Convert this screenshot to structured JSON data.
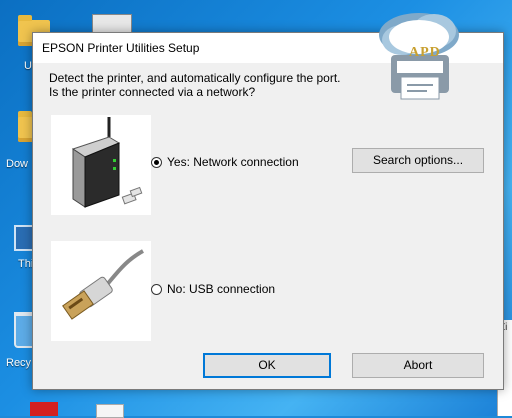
{
  "desktop": {
    "labels": [
      "U",
      "Dow",
      "Thi",
      "Recy"
    ],
    "right_strip_text": "Zi"
  },
  "dialog": {
    "title": "EPSON Printer Utilities Setup",
    "prompt_line1": "Detect the printer, and automatically configure the port.",
    "prompt_line2": "Is the printer connected via a network?",
    "network_option": "Yes: Network connection",
    "usb_option": "No: USB connection",
    "search_button": "Search options...",
    "ok_button": "OK",
    "abort_button": "Abort",
    "selected": "network"
  },
  "logo": {
    "text": "APD"
  },
  "colors": {
    "accent": "#0078d7",
    "desktop": "#1c8fe3"
  }
}
